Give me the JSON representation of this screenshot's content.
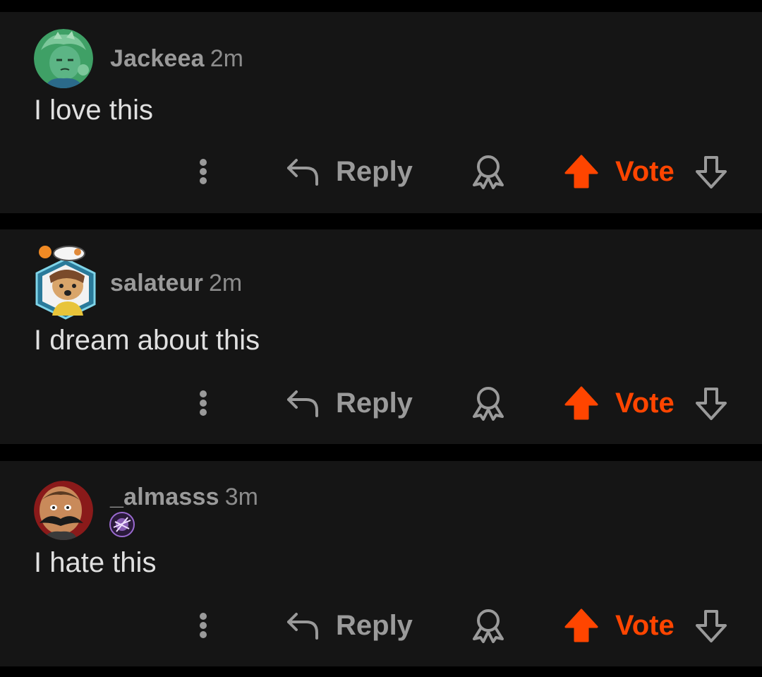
{
  "comments": [
    {
      "username": "Jackeea",
      "age": "2m",
      "body": "I love this",
      "avatar_icon": "green-character-avatar",
      "actions": {
        "reply": "Reply",
        "vote": "Vote"
      }
    },
    {
      "username": "salateur",
      "age": "2m",
      "body": "I dream about this",
      "avatar_icon": "dog-with-cat-hexagon-avatar",
      "actions": {
        "reply": "Reply",
        "vote": "Vote"
      }
    },
    {
      "username": "_almasss",
      "age": "3m",
      "body": "I hate this",
      "avatar_icon": "mustached-man-avatar",
      "flair_icon": "purple-magic-flair-icon",
      "actions": {
        "reply": "Reply",
        "vote": "Vote"
      }
    }
  ],
  "colors": {
    "background": "#000000",
    "card": "#151515",
    "username": "#9a9a9a",
    "body_text": "#e0e0e0",
    "upvote_accent": "#ff4500",
    "icon_gray": "#9a9a9a"
  }
}
